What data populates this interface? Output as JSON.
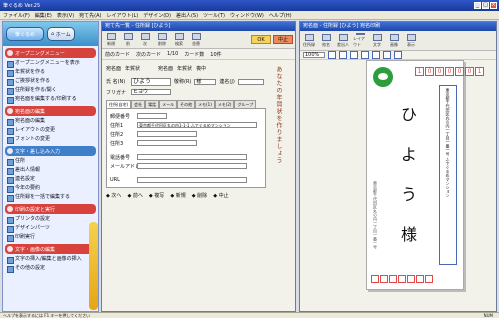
{
  "titlebar": {
    "title": "筆ぐるめ Ver.25"
  },
  "menubar": {
    "items": [
      "ファイル(F)",
      "編集(E)",
      "表示(V)",
      "宛て先(A)",
      "レイアウト(L)",
      "デザイン(D)",
      "差出人(S)",
      "ツール(T)",
      "ウィンドウ(W)",
      "ヘルプ(H)"
    ]
  },
  "sidebar": {
    "top": {
      "logo": "筆ぐるめ",
      "home": "ホーム"
    },
    "sections": [
      {
        "title": "オープニングメニュー",
        "color": "#d8423c",
        "items": [
          "オープニングメニューを表示",
          "年賀状を作る",
          "ご挨拶状を作る",
          "住所録を作る/開く",
          "宛名面を編集する/印刷する"
        ]
      },
      {
        "title": "宛名面の編集",
        "color": "#d8423c",
        "items": [
          "宛名面の編集",
          "レイアウトの変更",
          "フォントの変更"
        ]
      },
      {
        "title": "文字・差し込み入力",
        "color": "#3f7ec9",
        "items": [
          "住所",
          "差出人情報",
          "連名設定",
          "今年の要約",
          "住所録を一括で編集する"
        ]
      },
      {
        "title": "印刷の設定と実行",
        "color": "#d8423c",
        "items": [
          "プリンタの設定",
          "デザインパーツ",
          "印刷実行"
        ]
      },
      {
        "title": "文字・画像の編集",
        "color": "#d8423c",
        "items": [
          "文字の挿入/編集と画像の挿入",
          "その他の設定"
        ]
      }
    ]
  },
  "leftwin": {
    "title": "宛て先一覧 - 住所録 [ひよう]",
    "toolbar": [
      "新規",
      "前",
      "次",
      "削除",
      "検索",
      "並替"
    ],
    "toolbar2": [
      "前のカード",
      "次のカード",
      "1/10",
      "カード数",
      "10件"
    ],
    "buttons": [
      "OK",
      "中止"
    ],
    "checks": [
      "宛名面",
      "年賀状",
      "宛名面",
      "年賀状",
      "喪中"
    ],
    "name_label": "氏 名(N)",
    "name_value": "ひよう",
    "kana_label": "フリガナ",
    "kana_value": "ヒヨウ",
    "title_label": "敬称(R)",
    "title_value": "様",
    "joint_label": "連名(J)",
    "tabs": [
      "住所(自宅)",
      "会社",
      "電話",
      "メール",
      "その他",
      "メモ(1)",
      "メモ(2)",
      "グループ"
    ],
    "zip_label": "郵便番号",
    "zip_value": "",
    "addr1_label": "住所1",
    "addr1_value": "東京都千代田区丸の内1-1-1 ふでぐるめマンション",
    "addr2_label": "住所2",
    "addr3_label": "住所3",
    "tel_label": "電話番号",
    "mail_label": "メールアドレス",
    "url_label": "URL",
    "vertical_note": "あなたの年賀状を作りましょう",
    "footer": [
      "◆ 次へ",
      "◆ 前へ",
      "◆ 複写",
      "◆ 新規",
      "◆ 削除",
      "◆ 中止"
    ]
  },
  "rightwin": {
    "title": "宛名面 - 住所録 [ひよう] 宛名印刷",
    "toolbar": [
      "住所録",
      "宛名",
      "差出人",
      "レイアウト",
      "文字",
      "画像",
      "表示"
    ],
    "zoom": "100%",
    "zip_digits": [
      "1",
      "0",
      "0",
      "0",
      "0",
      "0",
      "1"
    ],
    "sender_zip": "",
    "recipient_address": "東京都千代田区丸の内一丁目一番一号 ふでぐるめマンション",
    "recipient_name_chars": [
      "ひ",
      "よ",
      "う"
    ],
    "honorific": "様",
    "sender_address": "東京都千代田区丸の内一丁目一番一号"
  },
  "statusbar": {
    "text": "ヘルプを表示するには F1 キーを押してください",
    "right": "NUM"
  },
  "colors": {
    "accent": "#1e47a8",
    "red_section": "#d8423c",
    "blue_section": "#3f7ec9",
    "stamp": "#2e9d3b"
  }
}
